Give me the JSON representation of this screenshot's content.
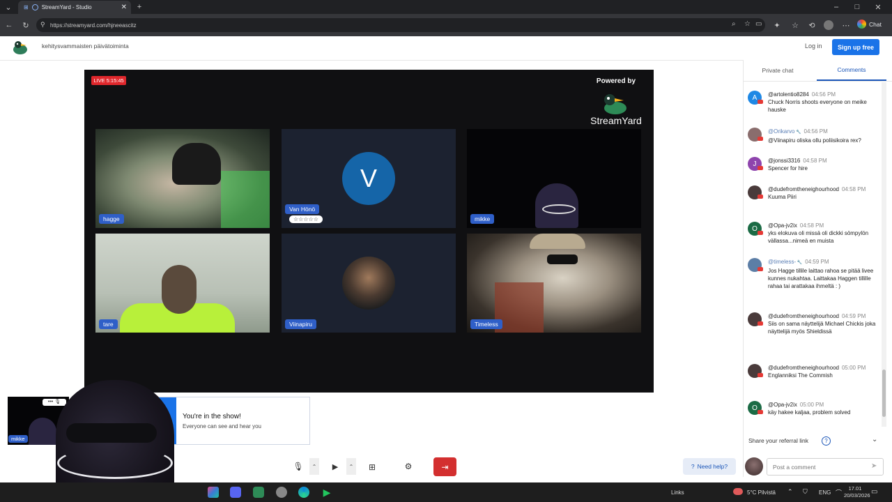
{
  "browser": {
    "tab_title": "StreamYard - Studio",
    "url": "https://streamyard.com/hjneeascitz",
    "chat_label": "Chat"
  },
  "header": {
    "broadcast_title": "kehitysvammaisten päivätoiminta",
    "login_label": "Log in",
    "signup_label": "Sign up free"
  },
  "stage": {
    "live_badge": "LIVE 5:15:45",
    "powered_by": "Powered by",
    "brand": "StreamYard",
    "participants": [
      {
        "name": "hagge",
        "kind": "video"
      },
      {
        "name": "Van Hönö",
        "kind": "avatar",
        "initial": "V",
        "avatar_color": "#1565a8",
        "badge": "☆☆☆☆☆"
      },
      {
        "name": "mikke",
        "kind": "video"
      },
      {
        "name": "tare",
        "kind": "video"
      },
      {
        "name": "Viinapiru",
        "kind": "photo"
      },
      {
        "name": "Timeless",
        "kind": "video"
      }
    ]
  },
  "self_view": {
    "name": "mikke",
    "toast_title": "You're in the show!",
    "toast_text": "Everyone can see and hear you"
  },
  "panel": {
    "tabs": [
      {
        "label": "Private chat"
      },
      {
        "label": "Comments"
      }
    ],
    "comments": [
      {
        "user": "@artolentio8284",
        "time": "04:56 PM",
        "text": "Chuck Norris shoots everyone on meike hauske",
        "initial": "A",
        "color": "#1e88e5",
        "mod": false
      },
      {
        "user": "@Orikarvo",
        "time": "04:56 PM",
        "text": "@Viinapiru oliska ollu poliisikoira rex?",
        "initial": "",
        "color": "#8a6d6d",
        "mod": true
      },
      {
        "user": "@jonssi3316",
        "time": "04:58 PM",
        "text": "Spencer for hire",
        "initial": "J",
        "color": "#8e44ad",
        "mod": false
      },
      {
        "user": "@dudefromtheneighourhood",
        "time": "04:58 PM",
        "text": "Kuuma Piiri",
        "initial": "",
        "color": "#4a3b3b",
        "mod": false
      },
      {
        "user": "@Opa-jv2ix",
        "time": "04:58 PM",
        "text": "yks elokuva oli missä oli dickki sömpylön vällassa...nimeä en muista",
        "initial": "O",
        "color": "#1b6b45",
        "mod": false
      },
      {
        "user": "@timeless-",
        "time": "04:59 PM",
        "text": "Jos Hagge tillile laittao rahoa se pitää livee kunnes nukahtaa. Laittakaa Haggen tillille rahaa tai arattakaa ihmeltä : )",
        "initial": "",
        "color": "#5c7ea6",
        "mod": true
      },
      {
        "user": "@dudefromtheneighourhood",
        "time": "04:59 PM",
        "text": "Siis on sama näyttelijä Michael Chickis joka näyttelijä myös Shieldissä",
        "initial": "",
        "color": "#4a3b3b",
        "mod": false
      },
      {
        "user": "@dudefromtheneighourhood",
        "time": "05:00 PM",
        "text": "Englanniksi The Commish",
        "initial": "",
        "color": "#4a3b3b",
        "mod": false
      },
      {
        "user": "@Opa-jv2ix",
        "time": "05:00 PM",
        "text": "käy hakee kaljaa, problem solved",
        "initial": "O",
        "color": "#1b6b45",
        "mod": false
      }
    ],
    "referral_label": "Share your referral link",
    "comment_placeholder": "Post a comment"
  },
  "toolbar": {
    "help_label": "Need help?"
  },
  "taskbar": {
    "links_label": "Links",
    "weather": "5°C Pilvistä",
    "lang": "ENG",
    "time": "17.01",
    "date": "20/03/2026"
  }
}
